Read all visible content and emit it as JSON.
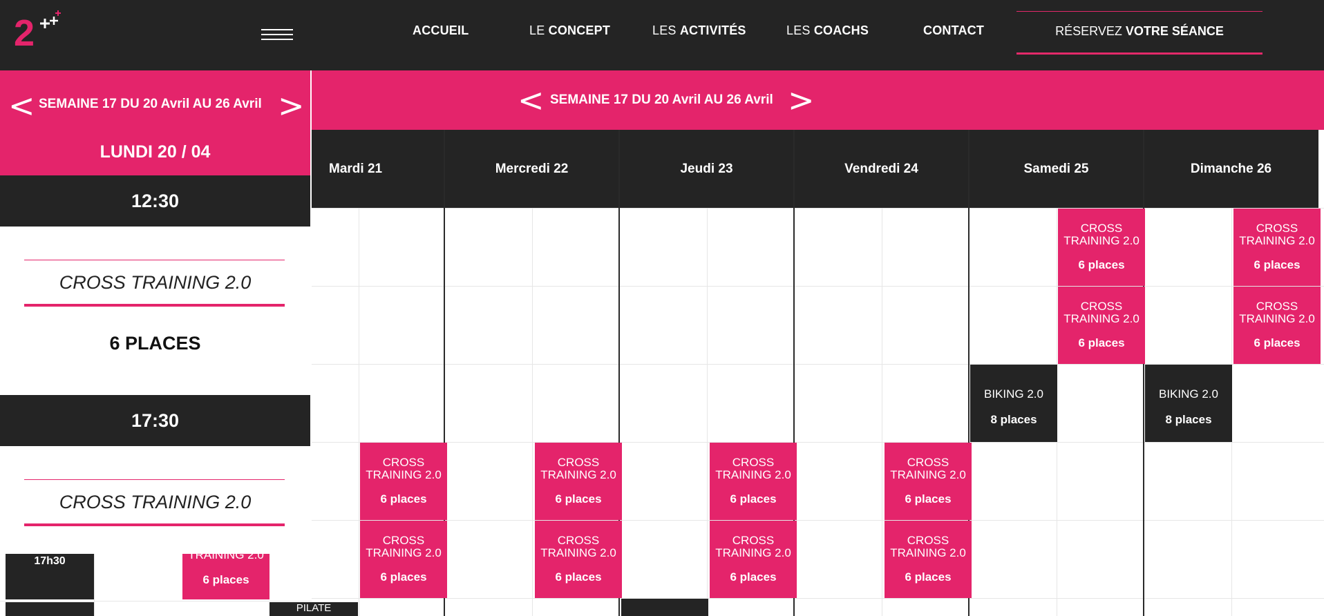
{
  "nav": {
    "accueil": "ACCUEIL",
    "concept_light": "LE",
    "concept_bold": "CONCEPT",
    "activites_light": "LES",
    "activites_bold": "ACTIVITÉS",
    "coachs_light": "LES",
    "coachs_bold": "COACHS",
    "contact": "CONTACT",
    "reserve_light": "RÉSERVEZ",
    "reserve_bold": "VOTRE SÉANCE"
  },
  "logo": {
    "text": "2",
    "icon": "plus-icon"
  },
  "week": {
    "label": "SEMAINE 17 DU 20 Avril AU 26 Avril",
    "prev": "<",
    "next": ">"
  },
  "mobile": {
    "day_title": "LUNDI 20 / 04",
    "slots": [
      {
        "time": "12:30",
        "course": "CROSS TRAINING 2.0",
        "places": "6 PLACES"
      },
      {
        "time": "17:30",
        "course": "CROSS TRAINING 2.0"
      }
    ]
  },
  "days": [
    {
      "label": "Mardi 21"
    },
    {
      "label": "Mercredi 22"
    },
    {
      "label": "Jeudi 23"
    },
    {
      "label": "Vendredi 24"
    },
    {
      "label": "Samedi 25"
    },
    {
      "label": "Dimanche 26"
    }
  ],
  "sessions": {
    "cross": {
      "name": "CROSS TRAINING 2.0",
      "places": "6 places"
    },
    "biking": {
      "name": "BIKING 2.0",
      "places": "8 places"
    }
  },
  "bottom": {
    "time": "17h30",
    "pink_name": "TRAINING 2.0",
    "pink_places": "6 places",
    "pilate": "PILATE"
  },
  "colors": {
    "pink": "#e4246b",
    "dark": "#242424"
  }
}
